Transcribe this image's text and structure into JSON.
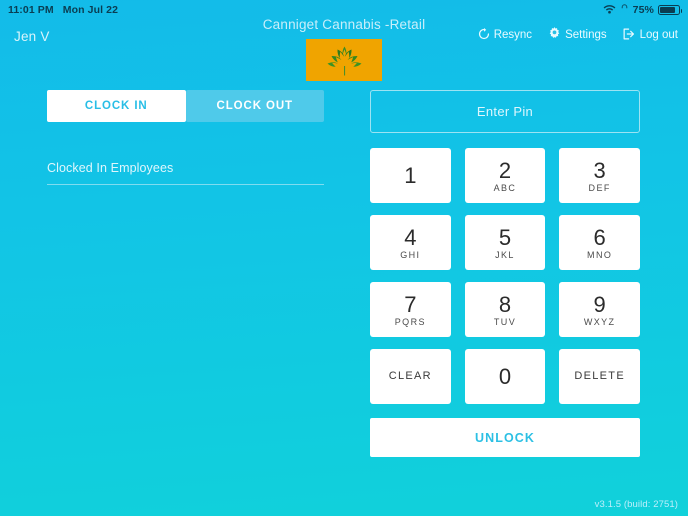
{
  "status_bar": {
    "time": "11:01 PM",
    "date": "Mon Jul 22",
    "battery_percent": "75%",
    "wifi_icon": "wifi-icon",
    "orientation_lock_icon": "rotation-lock-icon",
    "battery_icon": "battery-icon"
  },
  "header": {
    "user_name": "Jen V",
    "brand_title": "Canniget Cannabis -Retail",
    "logo_icon": "cannabis-leaf-icon",
    "logo_bg_color": "#F0A400",
    "actions": [
      {
        "label": "Resync",
        "icon": "refresh-icon"
      },
      {
        "label": "Settings",
        "icon": "gear-icon"
      },
      {
        "label": "Log out",
        "icon": "logout-icon"
      }
    ]
  },
  "left_panel": {
    "tabs": [
      {
        "label": "CLOCK IN",
        "active": true
      },
      {
        "label": "CLOCK OUT",
        "active": false
      }
    ],
    "section_label": "Clocked In Employees",
    "employees": []
  },
  "right_panel": {
    "pin_placeholder": "Enter Pin",
    "pin_value": "",
    "keypad": [
      {
        "digit": "1",
        "letters": ""
      },
      {
        "digit": "2",
        "letters": "ABC"
      },
      {
        "digit": "3",
        "letters": "DEF"
      },
      {
        "digit": "4",
        "letters": "GHI"
      },
      {
        "digit": "5",
        "letters": "JKL"
      },
      {
        "digit": "6",
        "letters": "MNO"
      },
      {
        "digit": "7",
        "letters": "PQRS"
      },
      {
        "digit": "8",
        "letters": "TUV"
      },
      {
        "digit": "9",
        "letters": "WXYZ"
      },
      {
        "digit": "CLEAR",
        "letters": "",
        "word": true
      },
      {
        "digit": "0",
        "letters": ""
      },
      {
        "digit": "DELETE",
        "letters": "",
        "word": true
      }
    ],
    "unlock_label": "UNLOCK"
  },
  "footer": {
    "version": "v3.1.5 (build: 2751)"
  },
  "colors": {
    "background_top": "#13BBE9",
    "background_bottom": "#11D1DA",
    "accent_white": "#FFFFFF",
    "tab_inactive": "#4FCAEA",
    "brand_amber": "#F0A400",
    "link_cyan": "#2CC0E4"
  }
}
